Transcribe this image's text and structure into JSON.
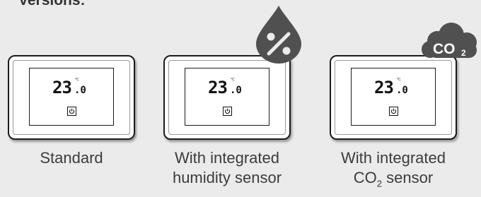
{
  "heading": "Versions:",
  "display": {
    "temperature": "23",
    "decimal": ".0",
    "unit": "°C"
  },
  "versions": [
    {
      "caption_line1": "Standard",
      "caption_line2": ""
    },
    {
      "caption_line1": "With integrated",
      "caption_line2": "humidity sensor",
      "badge_icon": "humidity-percent-drop-icon",
      "badge_text": "%"
    },
    {
      "caption_line1": "With integrated",
      "caption_line2_prefix": "CO",
      "caption_line2_sub": "2",
      "caption_line2_suffix": " sensor",
      "badge_icon": "co2-cloud-icon",
      "badge_text_main": "CO",
      "badge_text_sub": "2"
    }
  ],
  "colors": {
    "background": "#ebebeb",
    "badge": "#505050",
    "outline": "#1b1b1b"
  }
}
